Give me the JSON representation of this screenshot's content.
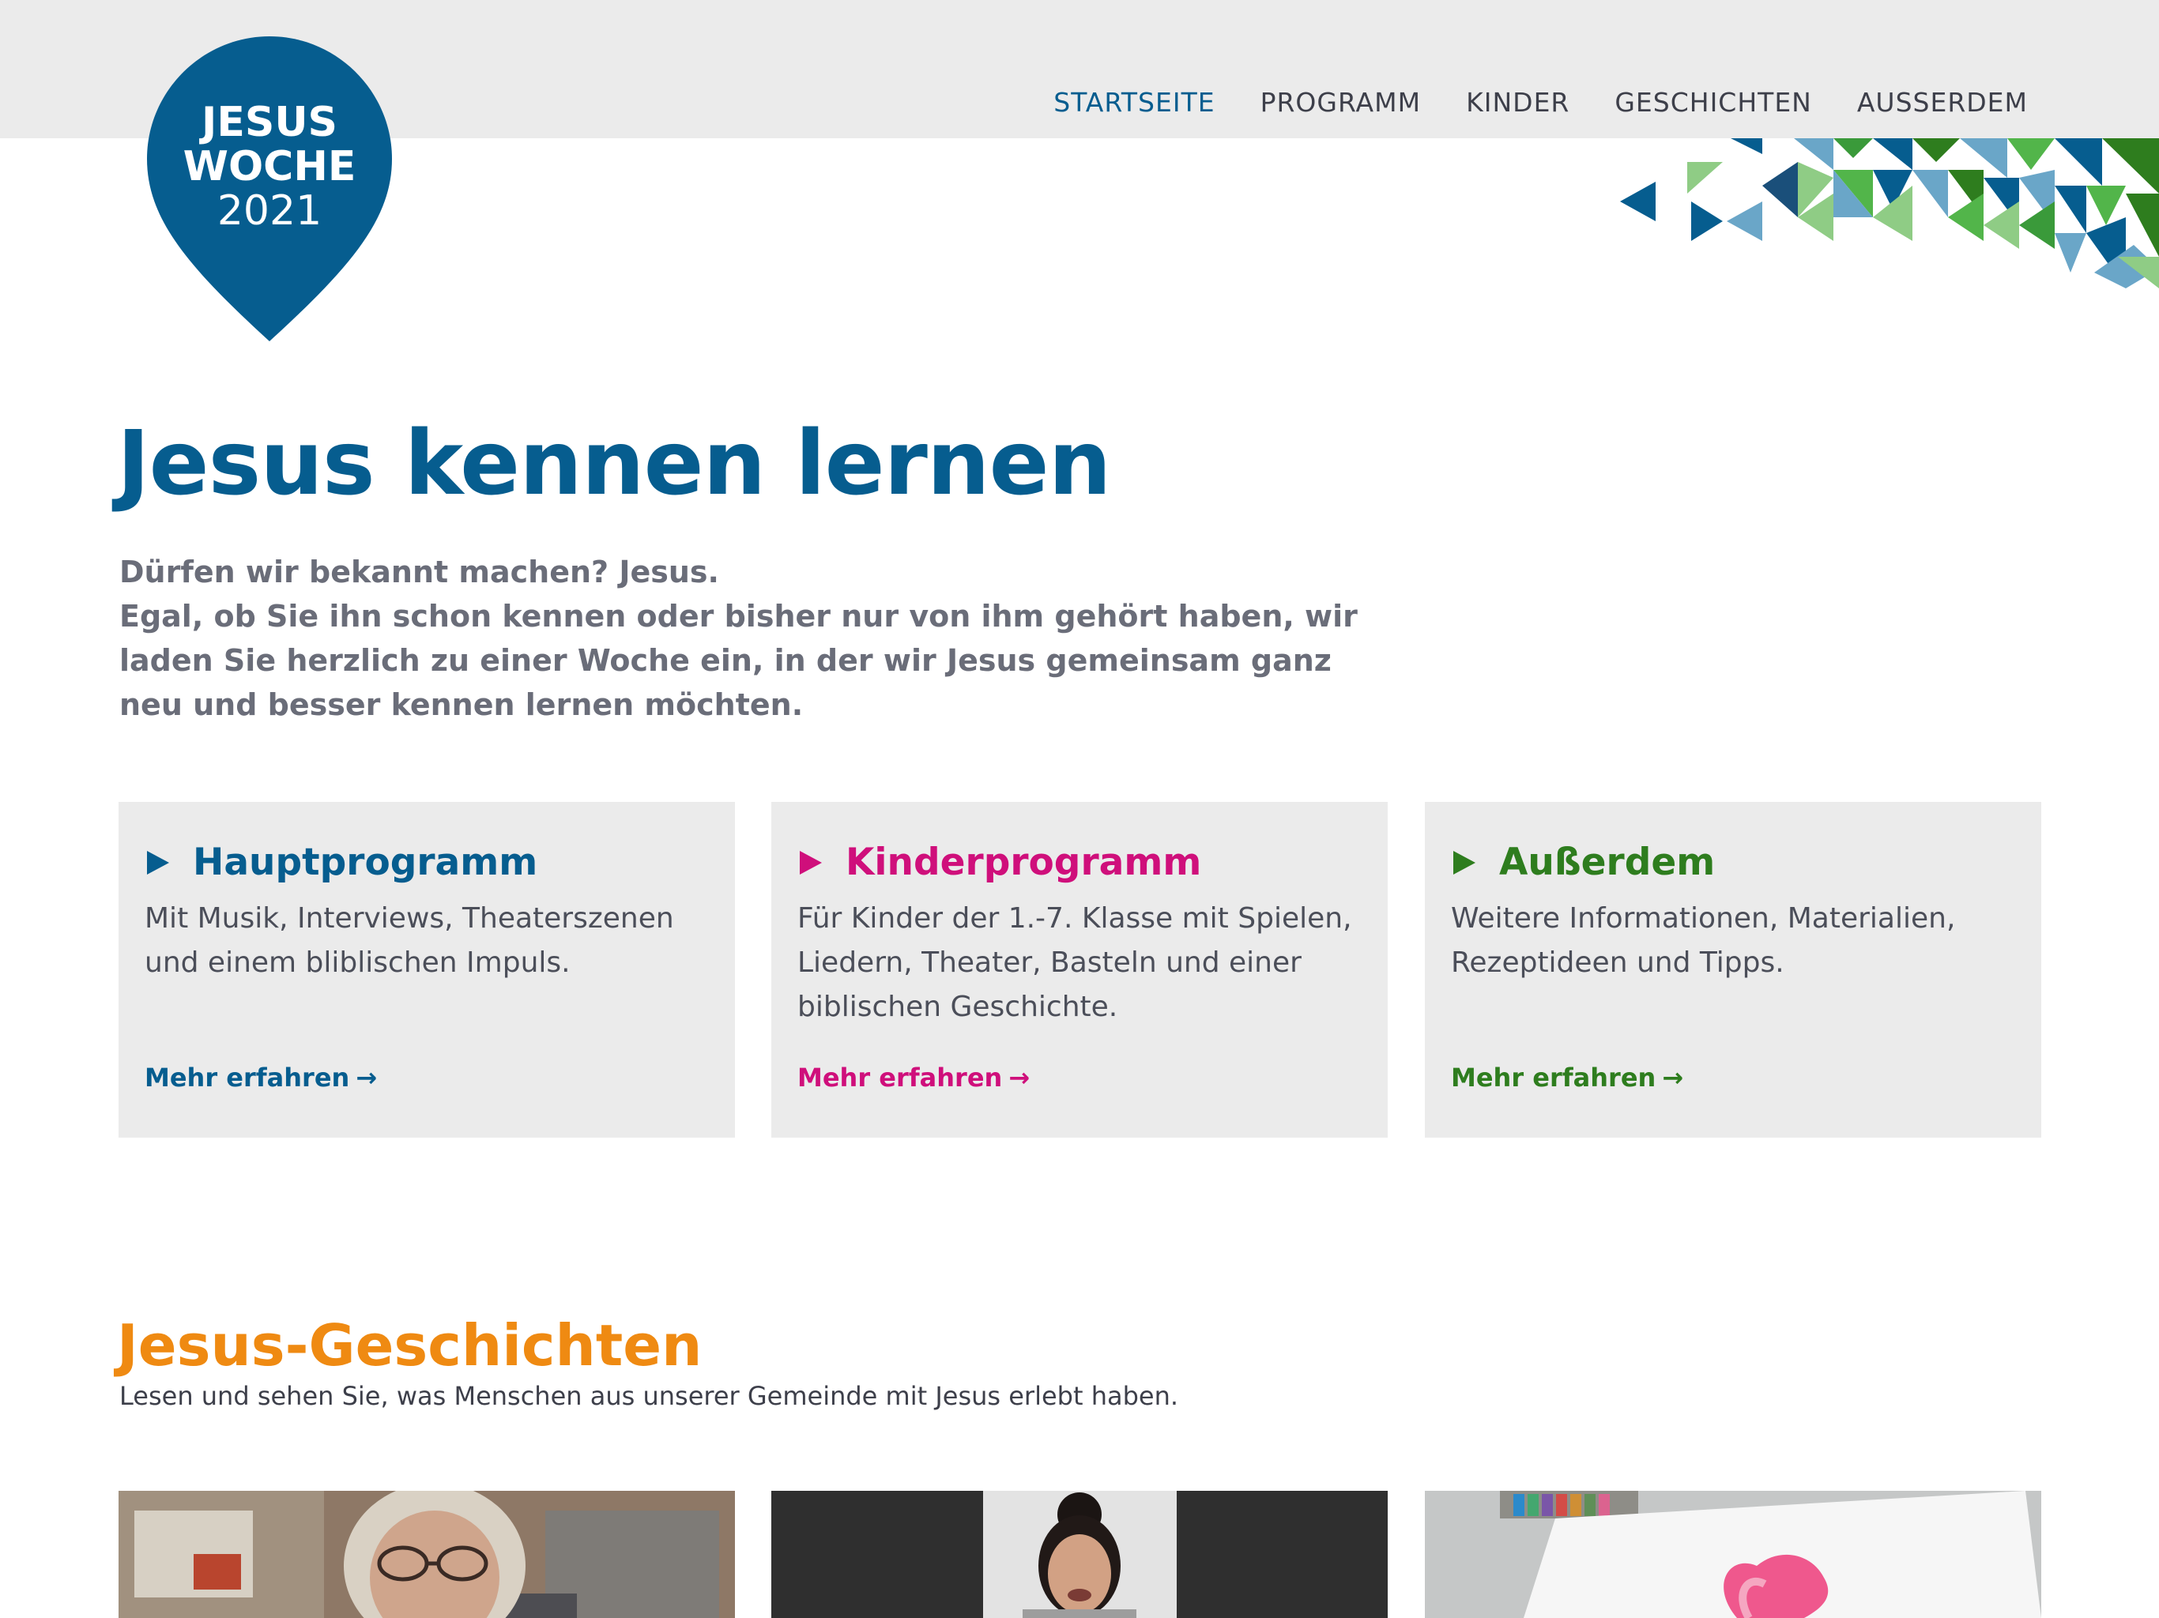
{
  "header": {
    "logo": {
      "line1": "JESUS",
      "line2": "WOCHE",
      "line3": "2021",
      "color": "#065d8f",
      "icon": "location-pin-icon"
    },
    "nav": [
      {
        "label": "STARTSEITE",
        "active": true
      },
      {
        "label": "PROGRAMM",
        "active": false
      },
      {
        "label": "KINDER",
        "active": false
      },
      {
        "label": "GESCHICHTEN",
        "active": false
      },
      {
        "label": "AUSSERDEM",
        "active": false
      }
    ]
  },
  "hero": {
    "title": "Jesus kennen lernen",
    "lines": [
      "Dürfen wir bekannt machen? Jesus.",
      "Egal, ob Sie ihn schon kennen oder bisher nur von ihm gehört haben, wir",
      "laden Sie herzlich zu einer Woche ein, in der wir Jesus gemeinsam ganz",
      "neu und besser kennen lernen möchten."
    ]
  },
  "cards": [
    {
      "title": "Hauptprogramm",
      "color": "#065d8f",
      "lines": [
        "Mit Musik, Interviews, Theaterszenen",
        "und einem bliblischen Impuls."
      ],
      "link": "Mehr erfahren",
      "link_icon": "arrow-right-icon"
    },
    {
      "title": "Kinderprogramm",
      "color": "#cf0f7b",
      "lines": [
        "Für Kinder der 1.-7. Klasse mit Spielen,",
        "Liedern, Theater, Basteln und einer",
        "biblischen Geschichte."
      ],
      "link": "Mehr erfahren",
      "link_icon": "arrow-right-icon"
    },
    {
      "title": "Außerdem",
      "color": "#2e7d1e",
      "lines": [
        "Weitere Informationen, Materialien,",
        "Rezeptideen und Tipps."
      ],
      "link": "Mehr erfahren",
      "link_icon": "arrow-right-icon"
    }
  ],
  "stories": {
    "title": "Jesus-Geschichten",
    "subtitle": "Lesen und sehen Sie, was Menschen aus unserer Gemeinde mit Jesus erlebt haben.",
    "thumbnails": [
      "photo-older-woman",
      "photo-girl",
      "photo-heart-drawing"
    ]
  },
  "colors": {
    "primary": "#065d8f",
    "magenta": "#cf0f7b",
    "green": "#2e7d1e",
    "orange": "#ef8a12",
    "topbar": "#ebebeb"
  }
}
